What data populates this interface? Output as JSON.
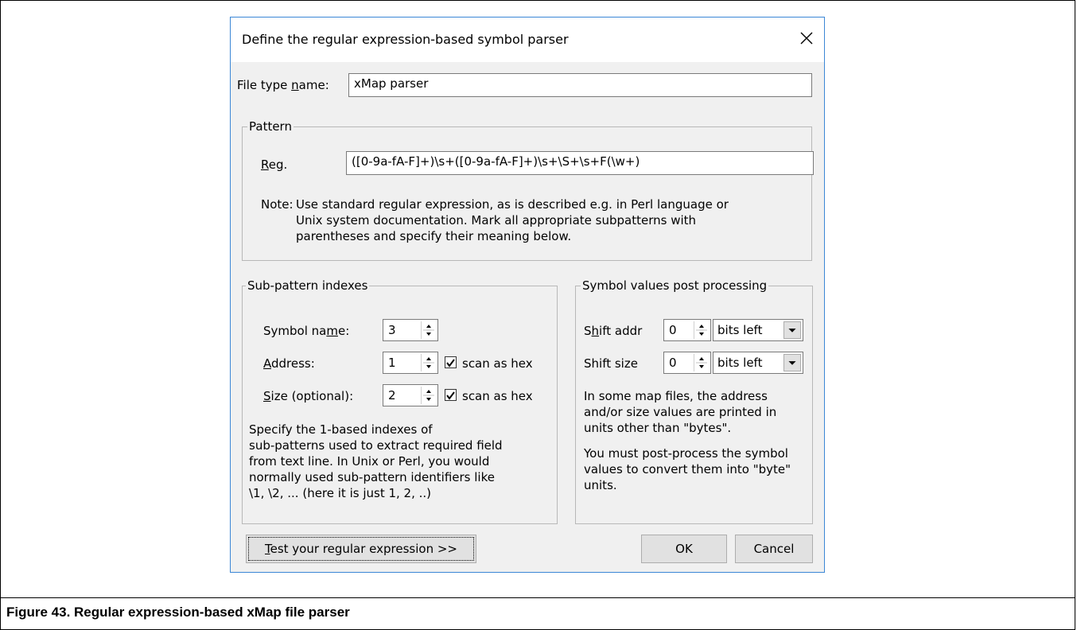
{
  "dialog": {
    "title": "Define the regular expression-based symbol parser",
    "file_type_label": "File type name:",
    "file_type_value": "xMap parser",
    "pattern_group": {
      "legend": "Pattern",
      "reg_label": "Reg.",
      "reg_value": "([0-9a-fA-F]+)\\s+([0-9a-fA-F]+)\\s+\\S+\\s+F(\\w+)",
      "note_prefix": "Note:",
      "note_line1": "Use standard regular expression, as is described e.g. in Perl language or",
      "note_line2": "Unix system documentation. Mark all appropriate subpatterns with",
      "note_line3": "parentheses and specify their meaning below."
    },
    "subpattern_group": {
      "legend": "Sub-pattern indexes",
      "symbol_name_label": "Symbol name:",
      "symbol_name_value": "3",
      "address_label": "Address:",
      "address_value": "1",
      "address_hex_checked": true,
      "address_hex_label": "scan as hex",
      "size_label": "Size (optional):",
      "size_value": "2",
      "size_hex_checked": true,
      "size_hex_label": "scan as hex",
      "help_lines": [
        "Specify the 1-based indexes of",
        "sub-patterns used to extract required field",
        "from text line. In Unix or Perl, you would",
        "normally used sub-pattern identifiers like",
        "\\1, \\2, ... (here it is just 1, 2, ..)"
      ]
    },
    "post_group": {
      "legend": "Symbol values post processing",
      "shift_addr_label": "Shift addr",
      "shift_addr_value": "0",
      "shift_addr_unit": "bits left",
      "shift_size_label": "Shift size",
      "shift_size_value": "0",
      "shift_size_unit": "bits left",
      "info1_lines": [
        "In some map files, the address",
        "and/or size values are printed in",
        "units other than \"bytes\"."
      ],
      "info2_lines": [
        "You must post-process the symbol",
        "values to convert them into \"byte\"",
        "units."
      ]
    },
    "test_button": "Test your regular expression >>",
    "ok_button": "OK",
    "cancel_button": "Cancel"
  },
  "caption": "Figure 43.  Regular expression-based xMap file parser",
  "colors": {
    "dialog_border": "#3b87d6",
    "dialog_bg": "#f0f0f0",
    "button_bg": "#e1e1e1"
  }
}
